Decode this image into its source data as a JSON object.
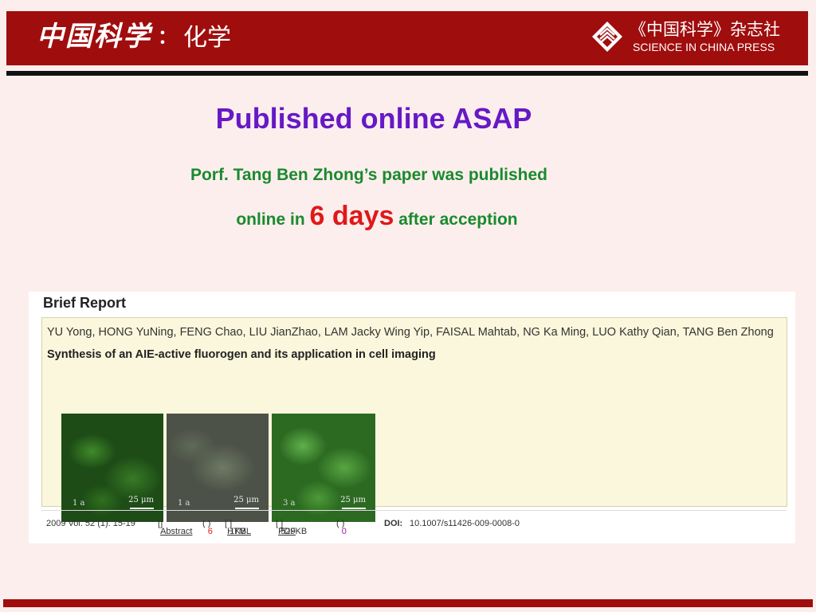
{
  "header": {
    "brand_cn": "中国科学",
    "separator": "：",
    "subject": "化学",
    "press_cn": "《中国科学》杂志社",
    "press_en": "SCIENCE IN CHINA PRESS",
    "logo_icon": "diamond-logo-icon"
  },
  "main": {
    "title": "Published online ASAP",
    "subtitle_line1": "Porf. Tang Ben Zhong’s paper was published",
    "subtitle_line2_prefix": "online in",
    "subtitle_line2_highlight": "6 days",
    "subtitle_line2_suffix": "after acception"
  },
  "report": {
    "heading": "Brief Report",
    "authors": "YU Yong, HONG YuNing, FENG Chao, LIU JianZhao, LAM Jacky Wing Yip, FAISAL Mahtab, NG Ka Ming, LUO Kathy Qian, TANG Ben Zhong",
    "paper_title": "Synthesis of an AIE-active fluorogen and its application in cell imaging",
    "images": [
      {
        "label": "1 a",
        "scale": "25 μm"
      },
      {
        "label": "1 a",
        "scale": "25 μm"
      },
      {
        "label": "3 a",
        "scale": "25 μm"
      }
    ],
    "footer": {
      "citation": "2009 Vol. 52 (1): 15-19",
      "abstract_link": "Abstract",
      "abstract_count": "6",
      "html_link": "HTML",
      "html_size": "1KB",
      "pdf_link": "PDF",
      "pdf_size": "529KB",
      "pdf_count": "0",
      "doi_label": "DOI:",
      "doi_value": "10.1007/s11426-009-0008-0"
    }
  },
  "colors": {
    "header_red": "#a00d0d",
    "title_purple": "#6619c5",
    "subtitle_green": "#1a8a2d",
    "highlight_red": "#e01818",
    "background": "#fdeeee"
  }
}
